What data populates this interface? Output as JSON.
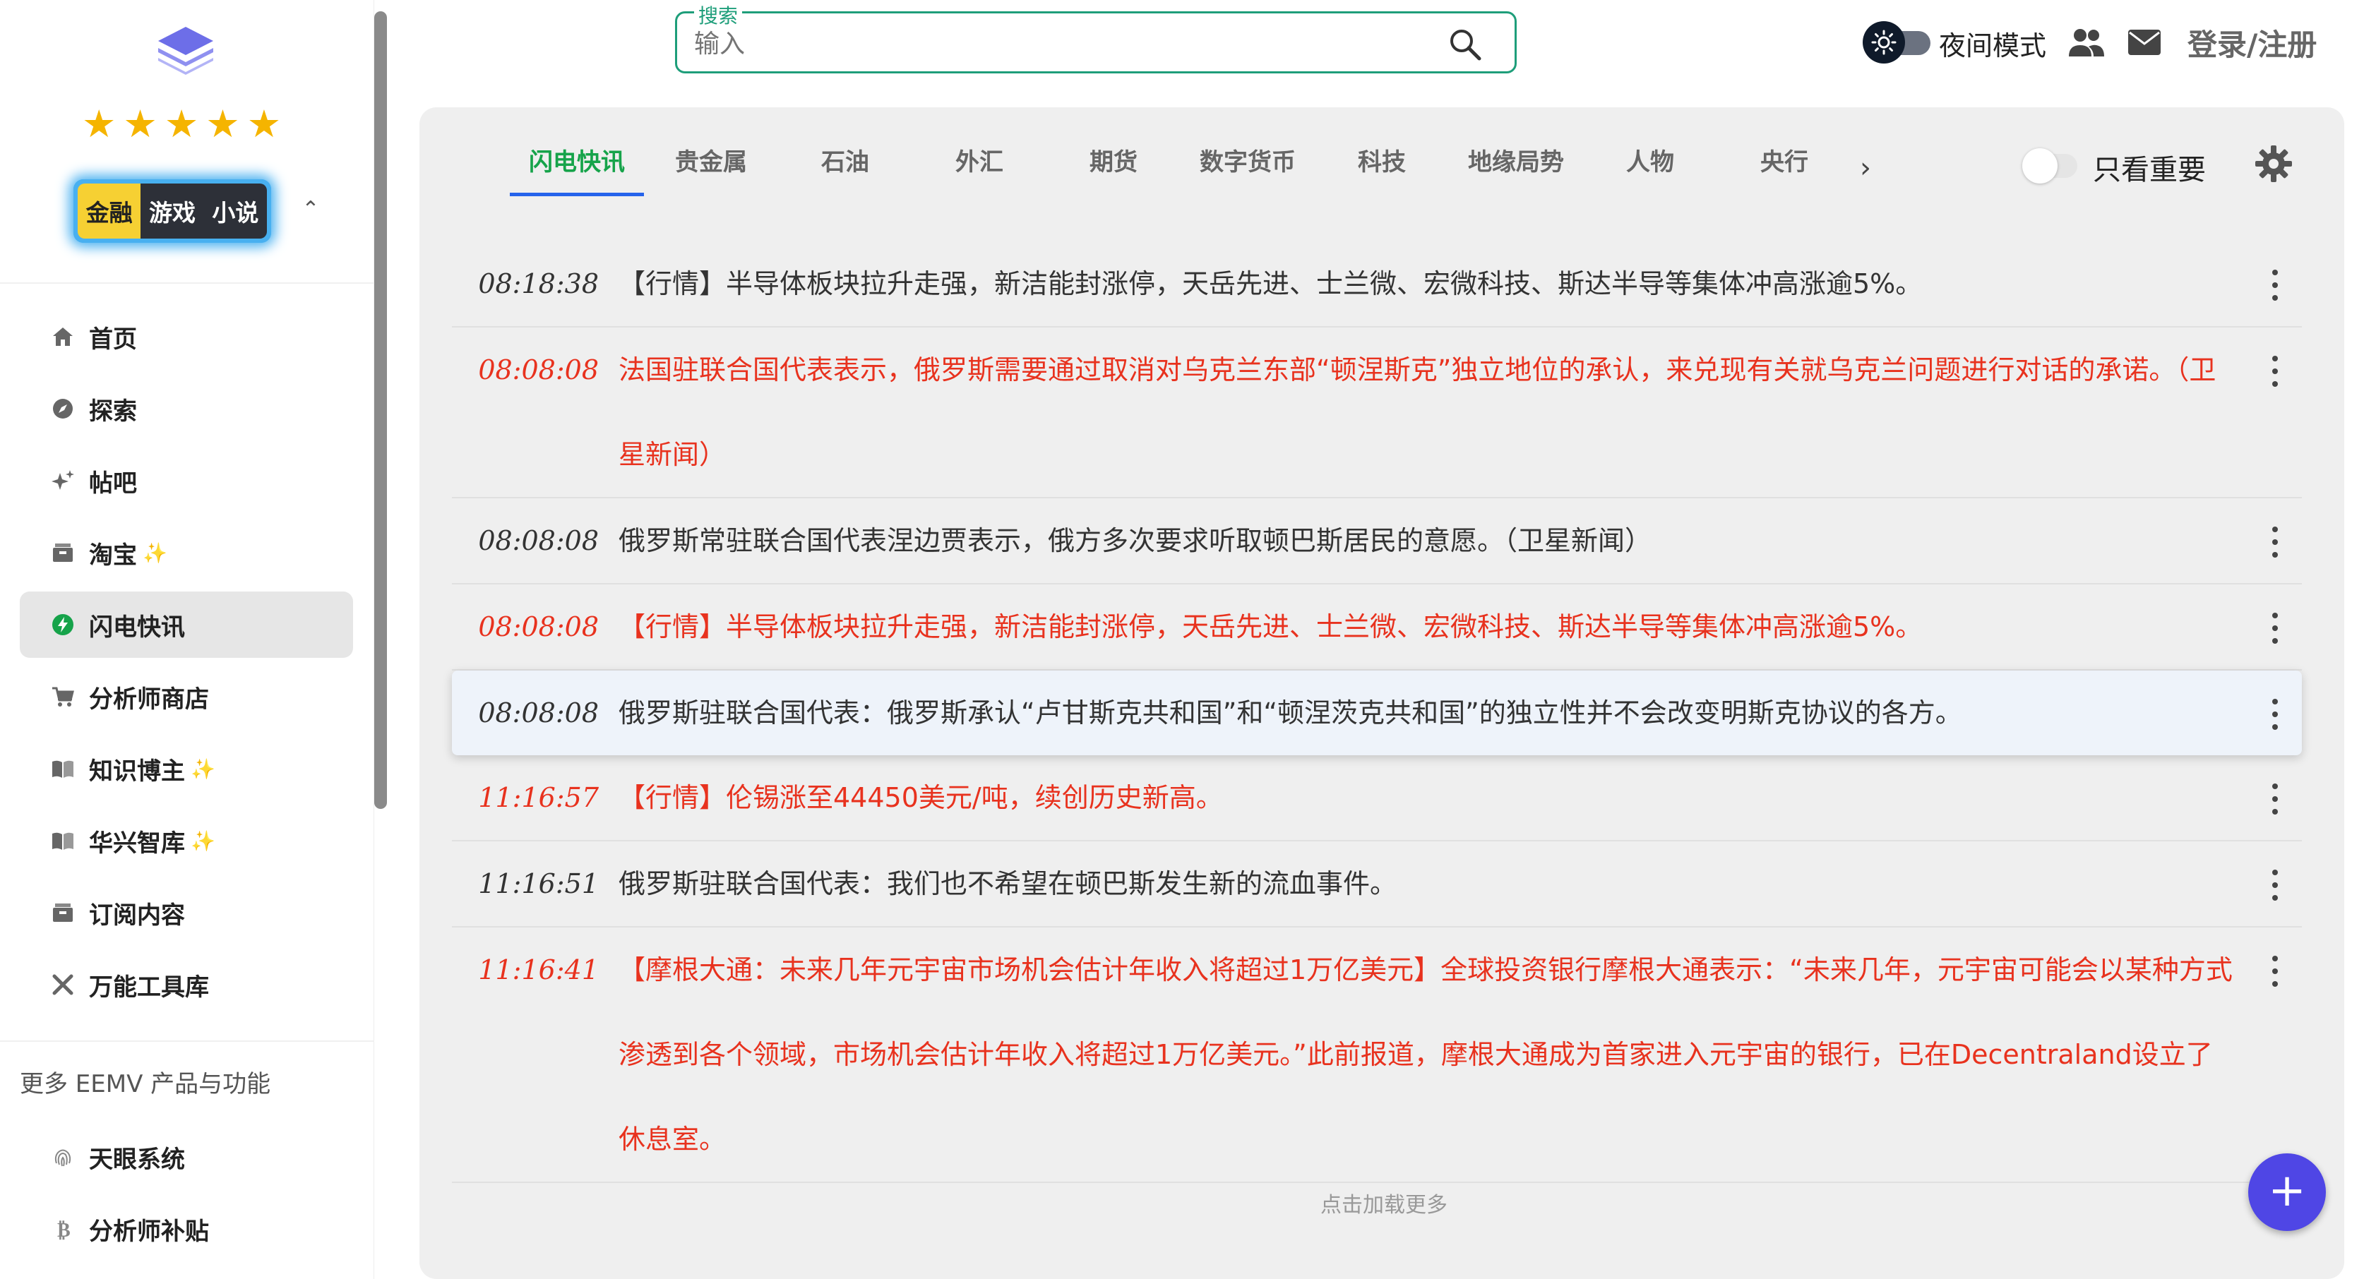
{
  "sidebar": {
    "modes": [
      "金融",
      "游戏",
      "小说"
    ],
    "nav": [
      {
        "label": "首页",
        "icon": "home-icon",
        "spark": false
      },
      {
        "label": "探索",
        "icon": "compass-icon",
        "spark": false
      },
      {
        "label": "帖吧",
        "icon": "sparkle-icon",
        "spark": false
      },
      {
        "label": "淘宝",
        "icon": "box-icon",
        "spark": true
      },
      {
        "label": "闪电快讯",
        "icon": "lightning-icon",
        "spark": false,
        "active": true
      },
      {
        "label": "分析师商店",
        "icon": "cart-icon",
        "spark": false
      },
      {
        "label": "知识博主",
        "icon": "book-icon",
        "spark": true
      },
      {
        "label": "华兴智库",
        "icon": "book-icon",
        "spark": true
      },
      {
        "label": "订阅内容",
        "icon": "box-icon",
        "spark": false
      },
      {
        "label": "万能工具库",
        "icon": "tools-icon",
        "spark": false
      }
    ],
    "more_title": "更多 EEMV 产品与功能",
    "more_nav": [
      {
        "label": "天眼系统",
        "icon": "fingerprint-icon"
      },
      {
        "label": "分析师补贴",
        "icon": "bitcoin-icon"
      }
    ]
  },
  "header": {
    "search_label": "搜索",
    "search_placeholder": "输入",
    "night_mode_label": "夜间模式",
    "login_label": "登录/注册"
  },
  "tabs": [
    "闪电快讯",
    "贵金属",
    "石油",
    "外汇",
    "期货",
    "数字货币",
    "科技",
    "地缘局势",
    "人物",
    "央行"
  ],
  "active_tab": 0,
  "important_only_label": "只看重要",
  "feed": [
    {
      "time": "08:18:38",
      "text": "【行情】半导体板块拉升走强，新洁能封涨停，天岳先进、士兰微、宏微科技、斯达半导等集体冲高涨逾5%。",
      "red": false,
      "lines": 1
    },
    {
      "time": "08:08:08",
      "text": "法国驻联合国代表表示，俄罗斯需要通过取消对乌克兰东部“顿涅斯克”独立地位的承认，来兑现有关就乌克兰问题进行对话的承诺。（卫星新闻）",
      "red": true,
      "lines": 2
    },
    {
      "time": "08:08:08",
      "text": "俄罗斯常驻联合国代表涅边贾表示，俄方多次要求听取顿巴斯居民的意愿。（卫星新闻）",
      "red": false,
      "lines": 1
    },
    {
      "time": "08:08:08",
      "text": "【行情】半导体板块拉升走强，新洁能封涨停，天岳先进、士兰微、宏微科技、斯达半导等集体冲高涨逾5%。",
      "red": true,
      "lines": 1
    },
    {
      "time": "08:08:08",
      "text": "俄罗斯驻联合国代表：俄罗斯承认“卢甘斯克共和国”和“顿涅茨克共和国”的独立性并不会改变明斯克协议的各方。",
      "red": false,
      "lines": 1,
      "highlight": true
    },
    {
      "time": "11:16:57",
      "text": "【行情】伦锡涨至44450美元/吨，续创历史新高。",
      "red": true,
      "lines": 1
    },
    {
      "time": "11:16:51",
      "text": "俄罗斯驻联合国代表：我们也不希望在顿巴斯发生新的流血事件。",
      "red": false,
      "lines": 1
    },
    {
      "time": "11:16:41",
      "text": "【摩根大通：未来几年元宇宙市场机会估计年收入将超过1万亿美元】全球投资银行摩根大通表示：“未来几年，元宇宙可能会以某种方式渗透到各个领域，市场机会估计年收入将超过1万亿美元。”此前报道，摩根大通成为首家进入元宇宙的银行，已在Decentraland设立了休息室。",
      "red": true,
      "lines": 3
    }
  ],
  "load_more": "点击加载更多",
  "colors": {
    "accent_green": "#16a34a",
    "tab_underline": "#2563eb",
    "news_red": "#e8321e",
    "search_border": "#1e9e7a",
    "fab": "#4f46e5",
    "star": "#f5b400"
  }
}
